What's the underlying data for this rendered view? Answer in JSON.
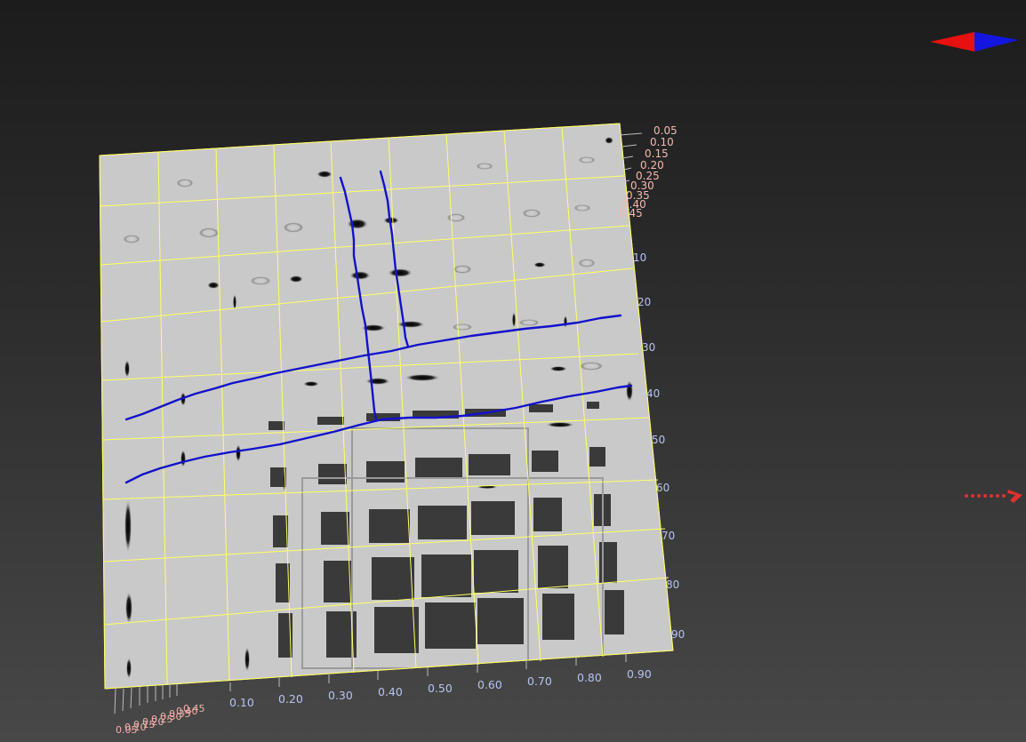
{
  "viewer": {
    "background_colors": [
      "#1c1c1c",
      "#484848"
    ],
    "grid_color": "#ffff66",
    "path_color": "#1010d0"
  },
  "axes": {
    "depth_ticks": [
      "0.05",
      "0.10",
      "0.15",
      "0.20",
      "0.25",
      "0.30",
      "0.35",
      "0.40",
      "0.45"
    ],
    "row_ticks": [
      "10",
      "20",
      "30",
      "40",
      "50",
      "60",
      "70",
      "80",
      "90"
    ],
    "col_ticks": [
      "0.10",
      "0.20",
      "0.30",
      "0.40",
      "0.50",
      "0.60",
      "0.70",
      "0.80",
      "0.90"
    ],
    "corner_ticks": [
      "0.05",
      "0.10",
      "0.15",
      "0.20",
      "0.25",
      "0.30",
      "0.35",
      "0.40",
      "0.45"
    ]
  },
  "controls": {
    "orientation_gizmo": "orientation-arrows-icon",
    "side_handle": "red-dotted-arrow-icon"
  }
}
